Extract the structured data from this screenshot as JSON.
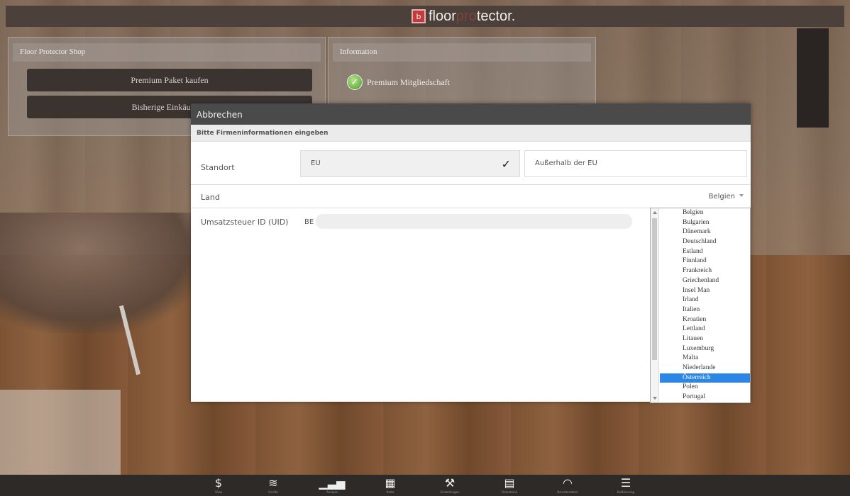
{
  "app": {
    "logo_mark": "b",
    "logo_left": "floor",
    "logo_hidden": "pro",
    "logo_right": "tector."
  },
  "shop_panel": {
    "title": "Floor Protector Shop",
    "buttons": [
      "Premium Paket kaufen",
      "Bisherige Einkäufe an"
    ]
  },
  "info_panel": {
    "title": "Information",
    "item": "Premium Mitgliedschaft"
  },
  "dialog": {
    "title": "Abbrechen",
    "subtitle": "Bitte Firmeninformationen eingeben",
    "location": {
      "label": "Standort",
      "options": [
        "EU",
        "Außerhalb der EU"
      ],
      "selected": "EU",
      "selected_mark": "✓"
    },
    "country": {
      "label": "Land",
      "value": "Belgien"
    },
    "vat": {
      "label": "Umsatzsteuer ID (UID)",
      "prefix": "BE",
      "value": "",
      "placeholder": ""
    }
  },
  "dropdown": {
    "options": [
      "Belgien",
      "Bulgarien",
      "Dänemark",
      "Deutschland",
      "Estland",
      "Finnland",
      "Frankreich",
      "Griechenland",
      "Insel Man",
      "Irland",
      "Italien",
      "Kroatien",
      "Lettland",
      "Litauen",
      "Luxemburg",
      "Malta",
      "Niederlande",
      "Österreich",
      "Polen",
      "Portugal"
    ],
    "highlighted": "Österreich"
  },
  "bottom_nav": [
    {
      "icon": "dollar-icon",
      "glyph": "$",
      "label": "Shop"
    },
    {
      "icon": "layers-icon",
      "glyph": "≋",
      "label": "Geräte"
    },
    {
      "icon": "chart-icon",
      "glyph": "▁▃▅",
      "label": "Analyse"
    },
    {
      "icon": "map-icon",
      "glyph": "▦",
      "label": "Karte"
    },
    {
      "icon": "tools-icon",
      "glyph": "⚒",
      "label": "Einstellungen"
    },
    {
      "icon": "clipboard-icon",
      "glyph": "▤",
      "label": "Datenbank"
    },
    {
      "icon": "gauge-icon",
      "glyph": "◠",
      "label": "Benutzerdaten"
    },
    {
      "icon": "sliders-icon",
      "glyph": "☰",
      "label": "Kalibrierung"
    }
  ]
}
